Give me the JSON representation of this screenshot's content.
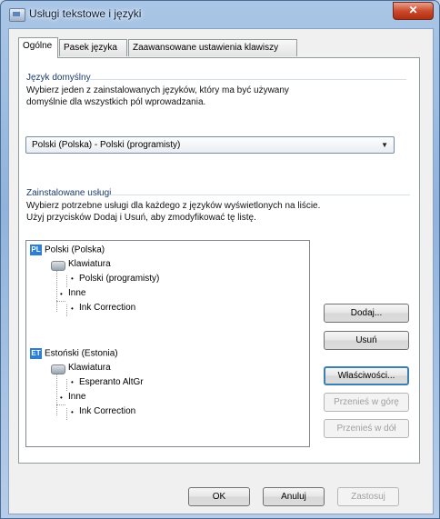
{
  "window": {
    "title": "Usługi tekstowe i języki",
    "close_label": "✕"
  },
  "tabs": [
    {
      "label": "Ogólne",
      "active": true
    },
    {
      "label": "Pasek języka",
      "active": false
    },
    {
      "label": "Zaawansowane ustawienia klawiszy",
      "active": false
    }
  ],
  "default_language": {
    "group_label": "Język domyślny",
    "description_line1": "Wybierz jeden z zainstalowanych języków, który ma być używany",
    "description_line2": "domyślnie dla wszystkich pól wprowadzania.",
    "selected": "Polski (Polska) - Polski (programisty)"
  },
  "installed_services": {
    "group_label": "Zainstalowane usługi",
    "description_line1": "Wybierz potrzebne usługi dla każdego z języków wyświetlonych na liście.",
    "description_line2": "Użyj przycisków Dodaj i Usuń, aby zmodyfikować tę listę.",
    "tree": {
      "lang1": {
        "badge": "PL",
        "name": "Polski (Polska)"
      },
      "lang1_keyboard": "Klawiatura",
      "lang1_layout": "Polski (programisty)",
      "lang1_other": "Inne",
      "lang1_other_item": "Ink Correction",
      "lang2": {
        "badge": "ET",
        "name": "Estoński (Estonia)"
      },
      "lang2_keyboard": "Klawiatura",
      "lang2_layout": "Esperanto AltGr",
      "lang2_other": "Inne",
      "lang2_other_item": "Ink Correction"
    },
    "buttons": {
      "add": "Dodaj...",
      "remove": "Usuń",
      "properties": "Właściwości...",
      "move_up": "Przenieś w górę",
      "move_down": "Przenieś w dół"
    }
  },
  "footer": {
    "ok": "OK",
    "cancel": "Anuluj",
    "apply": "Zastosuj"
  }
}
